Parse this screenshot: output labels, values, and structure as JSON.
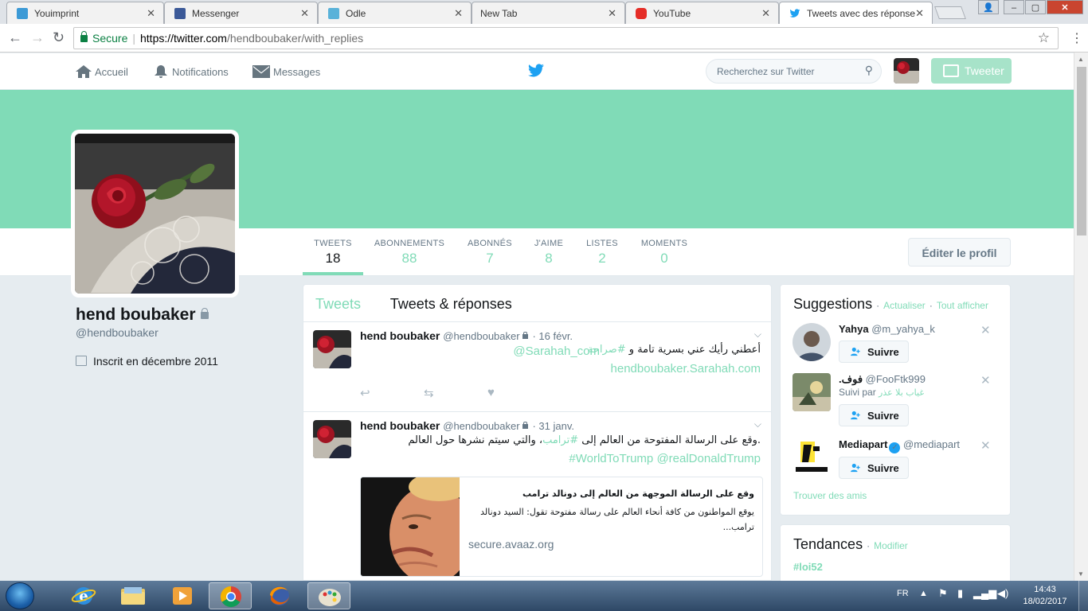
{
  "browser": {
    "tabs": [
      {
        "title": "Youimprint",
        "color": "#3c9ad6"
      },
      {
        "title": "Messenger",
        "color": "#3b5998"
      },
      {
        "title": "Odle",
        "color": "#59b2d9"
      },
      {
        "title": "New Tab",
        "color": ""
      },
      {
        "title": "YouTube",
        "color": "#e52d27"
      },
      {
        "title": "Tweets avec des réponse",
        "color": "#1da1f2"
      }
    ],
    "secure_label": "Secure",
    "url_scheme_host": "https://twitter.com",
    "url_path": "/hendboubaker/with_replies"
  },
  "nav": {
    "home": "Accueil",
    "notifications": "Notifications",
    "messages": "Messages",
    "search_placeholder": "Recherchez sur Twitter",
    "tweet_button": "Tweeter"
  },
  "theme": {
    "accent": "#80dbb7",
    "banner": "#80dbb7"
  },
  "profile": {
    "name": "hend boubaker",
    "handle": "@hendboubaker",
    "joined": "Inscrit en décembre 2011",
    "edit_button": "Éditer le profil",
    "stats": [
      {
        "label": "TWEETS",
        "value": "18"
      },
      {
        "label": "ABONNEMENTS",
        "value": "88"
      },
      {
        "label": "ABONNÉS",
        "value": "7"
      },
      {
        "label": "J'AIME",
        "value": "8"
      },
      {
        "label": "LISTES",
        "value": "2"
      },
      {
        "label": "MOMENTS",
        "value": "0"
      }
    ]
  },
  "timeline": {
    "tab_tweets": "Tweets",
    "tab_replies": "Tweets & réponses",
    "tweets": [
      {
        "name": "hend boubaker",
        "handle": "@hendboubaker",
        "date": "· 16 févr.",
        "line1_text": "أعطني رأيك عني بسرية تامة و",
        "line1_tag": "#صراحة",
        "line2": "@Sarahah_com",
        "line3": "hendboubaker.Sarahah.com"
      },
      {
        "name": "hend boubaker",
        "handle": "@hendboubaker",
        "date": "· 31 janv.",
        "line1_a": ".وقع على الرسالة المفتوحة من العالم إلى",
        "line1_tag": "#ترامب",
        "line1_b": "، والتي سيتم نشرها حول العالم",
        "line2": "#WorldToTrump @realDonaldTrump",
        "card": {
          "title": "وقع على الرسالة الموجهة من العالم إلى دونالد ترامب",
          "description": "يوقع المواطنون من كافة أنحاء العالم على رسالة مفتوحة تقول: السيد دونالد ترامب...",
          "domain": "secure.avaaz.org"
        }
      }
    ]
  },
  "suggestions": {
    "title": "Suggestions",
    "refresh": "Actualiser",
    "view_all": "Tout afficher",
    "follow_label": "Suivre",
    "items": [
      {
        "name": "Yahya",
        "handle": "@m_yahya_k"
      },
      {
        "name": ".فوف",
        "handle": "@FooFtk999",
        "via": "Suivi par",
        "via_name": "غياب بلا عذر"
      },
      {
        "name": "Mediapart",
        "handle": "@mediapart",
        "verified": true
      }
    ],
    "find_friends": "Trouver des amis"
  },
  "trends": {
    "title": "Tendances",
    "change": "Modifier",
    "first": "#loi52"
  },
  "taskbar": {
    "lang": "FR",
    "time": "14:43",
    "date": "18/02/2017"
  }
}
